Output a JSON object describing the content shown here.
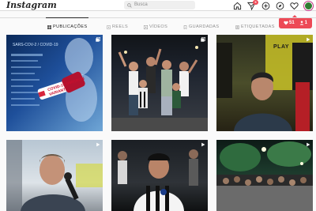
{
  "header": {
    "logo": "Instagram",
    "search_placeholder": "Busca",
    "icons": [
      "home-icon",
      "direct-messages-icon",
      "new-post-icon",
      "explore-icon",
      "activity-icon",
      "profile-avatar"
    ],
    "messages_badge": "5"
  },
  "notification": {
    "likes": "51",
    "follows": "1"
  },
  "tabs": [
    {
      "label": "PUBLICAÇÕES",
      "icon": "grid-icon",
      "active": true
    },
    {
      "label": "REELS",
      "icon": "reels-icon",
      "active": false
    },
    {
      "label": "VÍDEOS",
      "icon": "video-icon",
      "active": false
    },
    {
      "label": "GUARDADAS",
      "icon": "bookmark-icon",
      "active": false
    },
    {
      "label": "ETIQUETADAS",
      "icon": "tagged-icon",
      "active": false
    }
  ],
  "posts": [
    {
      "type": "carousel",
      "caption": "COVID-19 OMICRON VARIANT",
      "scene_text": "SARS-COV-2 / COVID-19"
    },
    {
      "type": "carousel",
      "caption": ""
    },
    {
      "type": "video",
      "caption": "PLAY"
    },
    {
      "type": "video",
      "caption": ""
    },
    {
      "type": "video",
      "caption": ""
    },
    {
      "type": "video",
      "caption": ""
    }
  ],
  "colors": {
    "accent": "#ed4956",
    "text": "#262626",
    "muted": "#8e8e8e",
    "border": "#dbdbdb"
  }
}
